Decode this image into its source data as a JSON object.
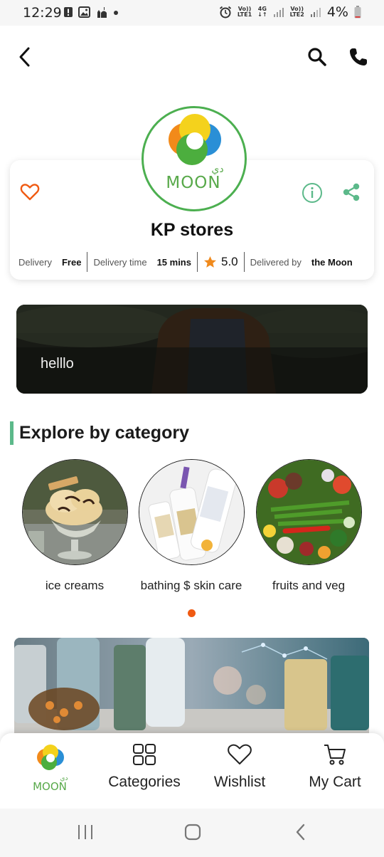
{
  "status_bar": {
    "time": "12:29",
    "battery": "4%",
    "sim1_top": "Vo))",
    "sim1_bottom": "LTE1",
    "net_type": "4G",
    "sim2_top": "Vo))",
    "sim2_bottom": "LTE2"
  },
  "store": {
    "name": "KP stores",
    "logo_text": "MOON",
    "logo_arabic": "دي",
    "delivery_label": "Delivery",
    "delivery_value": "Free",
    "delivery_time_label": "Delivery time",
    "delivery_time_value": "15 mins",
    "rating": "5.0",
    "delivered_by_label": "Delivered by",
    "delivered_by_value": "the Moon"
  },
  "banner": {
    "text": "helllo"
  },
  "categories_section": {
    "title": "Explore by category",
    "items": [
      {
        "label": "ice creams"
      },
      {
        "label": "bathing $ skin care"
      },
      {
        "label": "fruits and veg"
      }
    ]
  },
  "bottom_nav": {
    "home_logo_text": "MOON",
    "home_logo_arabic": "دي",
    "categories": "Categories",
    "wishlist": "Wishlist",
    "cart": "My Cart"
  },
  "colors": {
    "accent_orange": "#f05a12",
    "accent_green": "#4caf50",
    "section_bar": "#5cb98a"
  }
}
